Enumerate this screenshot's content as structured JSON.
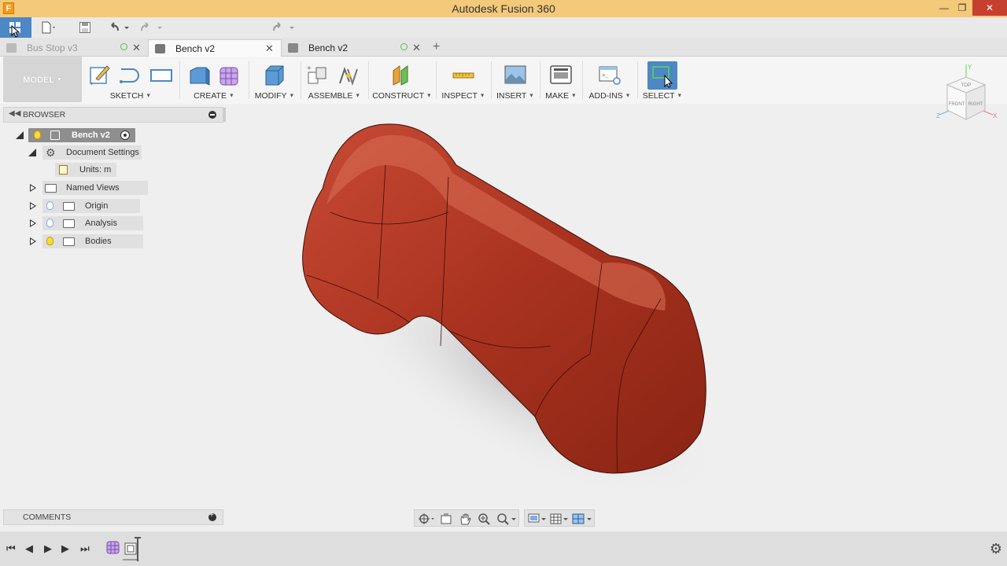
{
  "window": {
    "title": "Autodesk Fusion 360",
    "app_glyph": "F",
    "minimize": "—",
    "restore": "❐",
    "close": "✕"
  },
  "tabs": [
    {
      "label": "Bus Stop v3",
      "state": "inactive"
    },
    {
      "label": "Bench v2",
      "state": "active"
    },
    {
      "label": "Bench v2",
      "state": "inactive"
    }
  ],
  "toolbar": {
    "workspace": "MODEL",
    "groups": [
      "SKETCH",
      "CREATE",
      "MODIFY",
      "ASSEMBLE",
      "CONSTRUCT",
      "INSPECT",
      "INSERT",
      "MAKE",
      "ADD-INS",
      "SELECT"
    ]
  },
  "browser": {
    "title": "BROWSER",
    "root": "Bench v2",
    "document_settings": "Document Settings",
    "units": "Units: m",
    "items": [
      "Named Views",
      "Origin",
      "Analysis",
      "Bodies"
    ]
  },
  "comments": {
    "title": "COMMENTS"
  },
  "viewcube": {
    "top": "TOP",
    "front": "FRONT",
    "right": "RIGHT",
    "x": "X",
    "y": "Y",
    "z": "Z"
  },
  "colors": {
    "accent": "#4d87c4",
    "title_bar": "#f4c97a",
    "body": "#a8321f",
    "active_tool": "#3b6fb3"
  },
  "icons": {
    "timeline_first": "⏮",
    "timeline_prev": "◀",
    "timeline_play": "▶",
    "timeline_next": "▶",
    "timeline_last": "⏭",
    "settings": "⚙"
  }
}
